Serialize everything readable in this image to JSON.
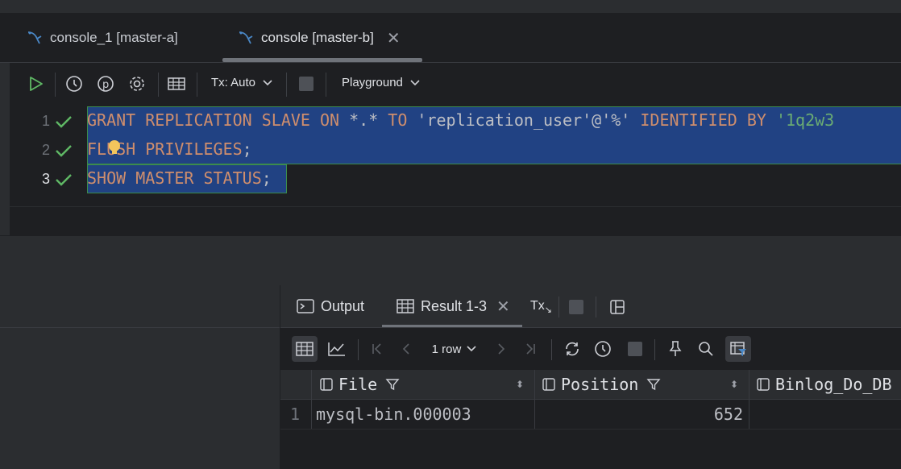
{
  "tabs": [
    {
      "label": "console_1 [master-a]",
      "active": false,
      "icon": "database-console-icon"
    },
    {
      "label": "console [master-b]",
      "active": true,
      "icon": "database-console-icon"
    }
  ],
  "toolbar": {
    "tx_label": "Tx: Auto",
    "playground_label": "Playground"
  },
  "editor": {
    "line_numbers": [
      "1",
      "2",
      "3"
    ],
    "lines": [
      {
        "kw1": "GRANT REPLICATION SLAVE ON ",
        "op": "*.*",
        "kw2": " TO ",
        "str1": "'replication_user'",
        "op2": "@",
        "str2": "'%'",
        "kw3": " IDENTIFIED BY ",
        "str3": "'1q2w3"
      },
      {
        "kw1": "FLUSH PRIVILEGES",
        "plain": ";"
      },
      {
        "kw1": "SHOW MASTER STATUS",
        "plain": ";"
      }
    ]
  },
  "results": {
    "tabs": [
      {
        "label": "Output",
        "icon": "console-output-icon"
      },
      {
        "label": "Result 1-3",
        "icon": "table-grid-icon",
        "active": true
      }
    ],
    "tx_label": "Tx",
    "row_count_label": "1 row",
    "columns": [
      "File",
      "Position",
      "Binlog_Do_DB"
    ],
    "rows": [
      {
        "num": "1",
        "file": "mysql-bin.000003",
        "position": "652",
        "binlog_do_db": ""
      }
    ]
  },
  "colors": {
    "keyword": "#cf8e6d",
    "string": "#6aab73",
    "selection": "#214283",
    "check": "#5fb865",
    "run": "#5fb865"
  }
}
